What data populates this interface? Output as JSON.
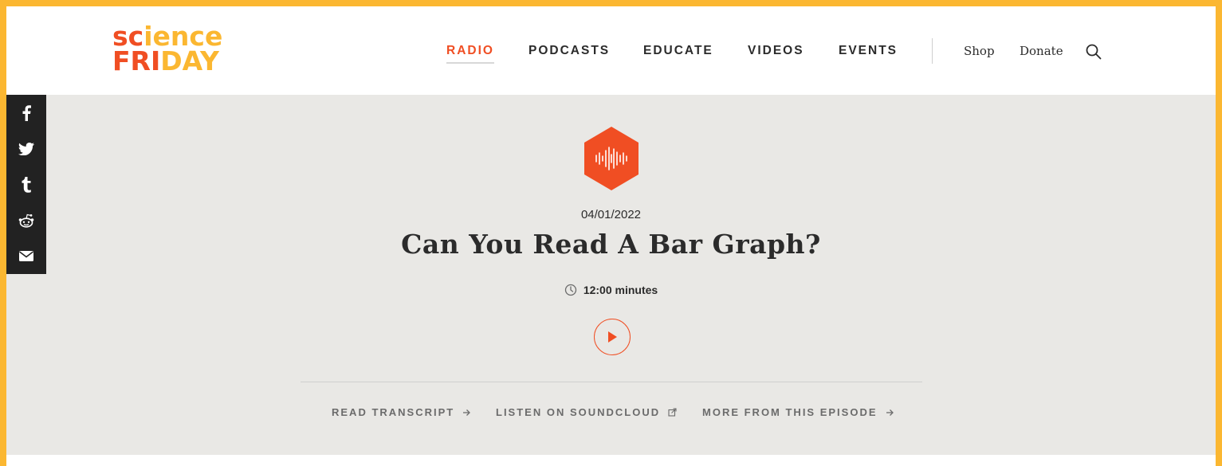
{
  "brand": {
    "logo_top_red": "sc",
    "logo_top_orange": "ience",
    "logo_bottom_red": "FRI",
    "logo_bottom_orange": "DAY"
  },
  "nav": {
    "items": [
      {
        "label": "RADIO",
        "active": true
      },
      {
        "label": "PODCASTS",
        "active": false
      },
      {
        "label": "EDUCATE",
        "active": false
      },
      {
        "label": "VIDEOS",
        "active": false
      },
      {
        "label": "EVENTS",
        "active": false
      }
    ],
    "shop": "Shop",
    "donate": "Donate"
  },
  "social": [
    "facebook-icon",
    "twitter-icon",
    "tumblr-icon",
    "reddit-icon",
    "email-icon"
  ],
  "episode": {
    "date": "04/01/2022",
    "title": "Can You Read A Bar Graph?",
    "duration": "12:00 minutes"
  },
  "actions": {
    "transcript": "READ TRANSCRIPT",
    "soundcloud": "LISTEN ON SOUNDCLOUD",
    "more": "MORE FROM THIS EPISODE"
  },
  "colors": {
    "accent": "#f04e23",
    "brand_orange": "#fbb731",
    "background": "#e9e8e5",
    "dark": "#222222"
  }
}
